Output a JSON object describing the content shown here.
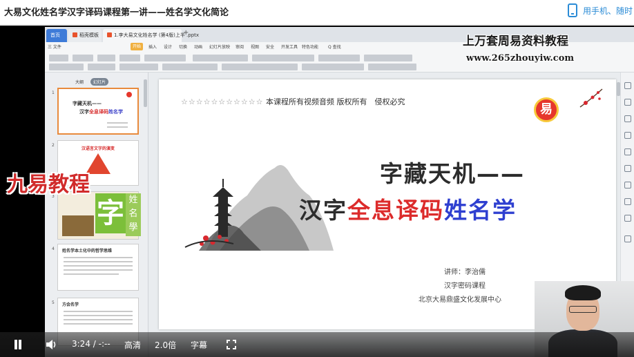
{
  "header": {
    "page_title": "大易文化姓名学汉字译码课程第一讲——姓名学文化简论",
    "phone_link": "用手机、随时"
  },
  "wps": {
    "tabs": [
      {
        "label": "首页"
      },
      {
        "label": "稻壳模板"
      },
      {
        "label": "1.李大易文化姓名学 (第4版)上半 .pptx"
      }
    ],
    "menu": [
      "三 文件",
      "开始",
      "插入",
      "设计",
      "切换",
      "动画",
      "幻灯片放映",
      "审阅",
      "视图",
      "安全",
      "开发工具",
      "特色功能",
      "Q 查找"
    ],
    "panel_tabs": [
      "大纲",
      "幻灯片"
    ]
  },
  "thumbnails": [
    {
      "num": "1",
      "title": "字藏天机——",
      "sub_a": "汉字",
      "sub_red": "全息译码",
      "sub_blue": "姓名学"
    },
    {
      "num": "2",
      "title": "汉语言文字的演变"
    },
    {
      "num": "3"
    },
    {
      "num": "4",
      "title": "姓名学本土化中的哲学思维"
    },
    {
      "num": "5",
      "title": "方会名学"
    }
  ],
  "watermarks": {
    "banner_top": "上万套周易资料教程",
    "banner_url": "www.265zhouyiw.com",
    "jiuyi": "九易教程",
    "zi": "字",
    "zi_side": [
      "姓",
      "名",
      "學"
    ]
  },
  "slide": {
    "stars": "☆☆☆☆☆☆☆☆☆☆☆",
    "copyright": "本课程所有视频音频 版权所有　侵权必究",
    "logo_glyph": "易",
    "title_line1": "字藏天机——",
    "title_line2_a": "汉字",
    "title_line2_red": "全息译码",
    "title_line2_blue": "姓名学",
    "lecturer": "讲师：李治儒",
    "course": "汉字密码课程",
    "org": "北京大易鼎盛文化发展中心"
  },
  "player": {
    "time": "3:24 / -:--",
    "quality": "高清",
    "speed": "2.0倍",
    "subtitles": "字幕"
  }
}
